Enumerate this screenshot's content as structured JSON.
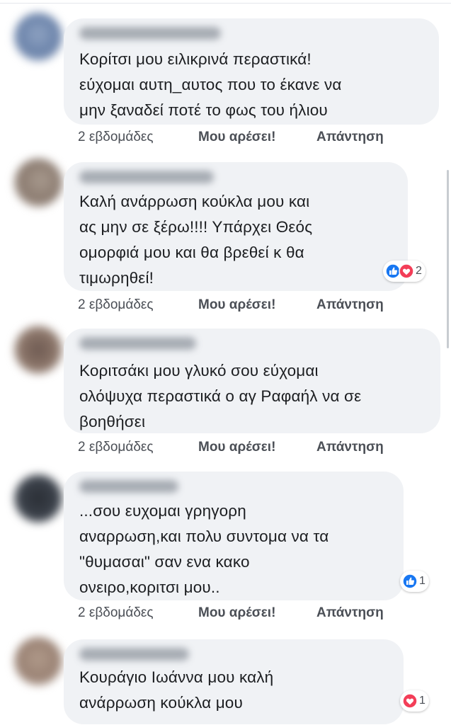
{
  "comments": [
    {
      "text": "Κορίτσι μου ειλικρινά περαστικά!\nεύχομαι αυτη_αυτος που το έκανε να\nμην ξαναδεί ποτέ το φως του ήλιου",
      "time": "2 εβδομάδες",
      "like_label": "Μου αρέσει!",
      "reply_label": "Απάντηση"
    },
    {
      "text": "Καλή ανάρρωση κούκλα μου και\nας μην σε ξέρω!!!! Υπάρχει Θεός\nομορφιά μου και θα βρεθεί κ θα\nτιμωρηθεί!",
      "time": "2 εβδομάδες",
      "like_label": "Μου αρέσει!",
      "reply_label": "Απάντηση",
      "reactions": {
        "icons": [
          "like-icon",
          "love-icon"
        ],
        "count": "2"
      }
    },
    {
      "text": "Κοριτσάκι μου γλυκό σου εύχομαι\nολόψυχα περαστικά ο αγ Ραφαήλ να σε\nβοηθήσει",
      "time": "2 εβδομάδες",
      "like_label": "Μου αρέσει!",
      "reply_label": "Απάντηση"
    },
    {
      "text": "...σου ευχομαι γρηγορη\nαναρρωση,και πολυ συντομα να τα\n\"θυμασαι\" σαν ενα κακο\nονειρο,κοριτσι μου..",
      "time": "2 εβδομάδες",
      "like_label": "Μου αρέσει!",
      "reply_label": "Απάντηση",
      "reactions": {
        "icons": [
          "like-icon"
        ],
        "count": "1"
      }
    },
    {
      "text": "Κουράγιο Ιωάννα μου καλή\nανάρρωση κούκλα μου",
      "reactions": {
        "icons": [
          "love-icon"
        ],
        "count": "1"
      }
    }
  ],
  "colors": {
    "bubble": "#f0f2f5",
    "like_blue": "#1877f2",
    "love_red": "#f33e58",
    "meta_text": "#4b4f56"
  }
}
